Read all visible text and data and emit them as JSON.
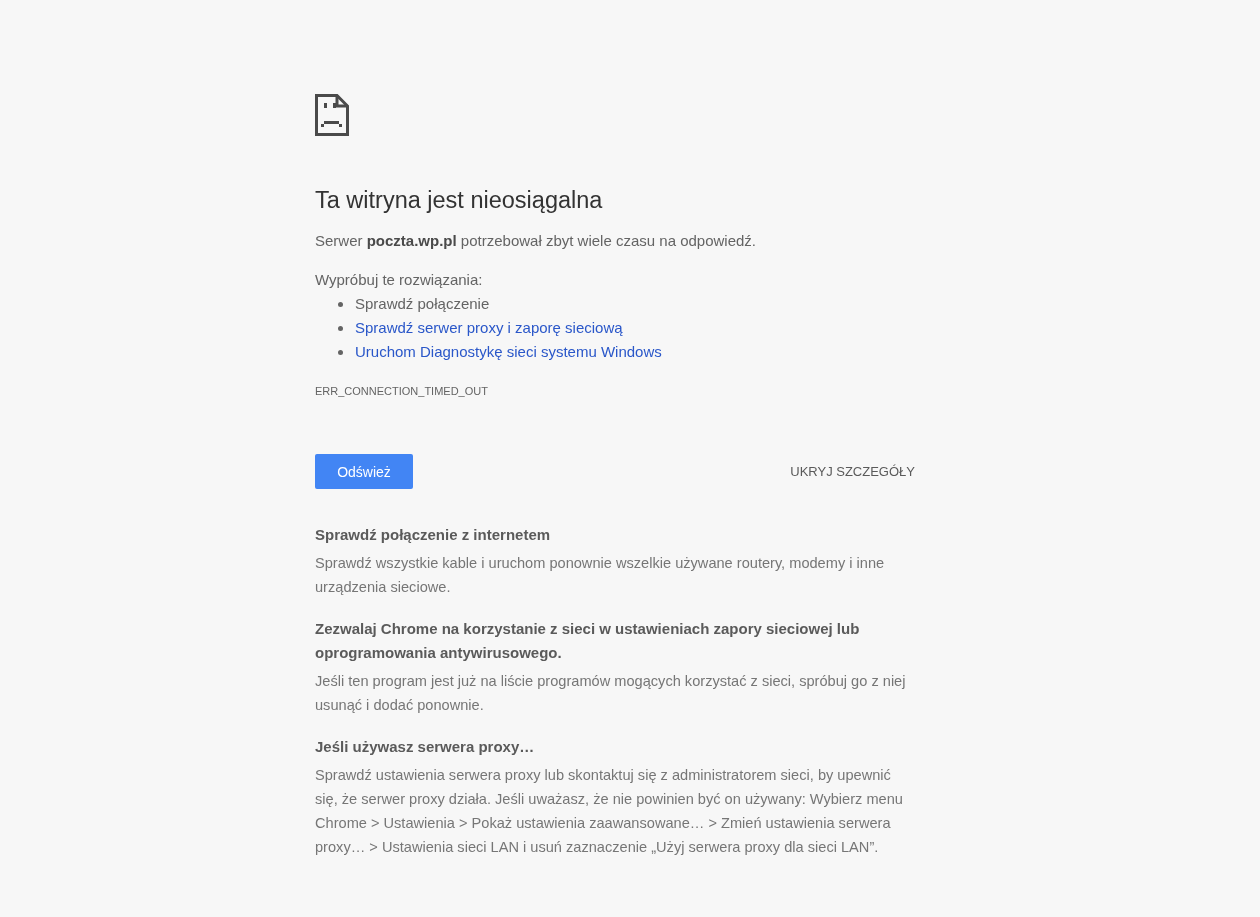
{
  "title": "Ta witryna jest nieosiągalna",
  "summary": "Serwer **poczta.wp.pl** potrzebował zbyt wiele czasu na odpowiedź.",
  "suggestions": {
    "intro": "Wypróbuj te rozwiązania:",
    "items": [
      {
        "kind": "text",
        "text": "Sprawdź połączenie"
      },
      {
        "kind": "link",
        "text": "Sprawdź serwer proxy i zaporę sieciową"
      },
      {
        "kind": "link",
        "text": "Uruchom Diagnostykę sieci systemu Windows"
      }
    ]
  },
  "error_code": "ERR_CONNECTION_TIMED_OUT",
  "buttons": {
    "reload": "Odśwież",
    "details_toggle": "UKRYJ SZCZEGÓŁY"
  },
  "details": [
    {
      "title": "Sprawdź połączenie z internetem",
      "body": "Sprawdź wszystkie kable i uruchom ponownie wszelkie używane routery, modemy i inne urządzenia sieciowe."
    },
    {
      "title": "Zezwalaj Chrome na korzystanie z sieci w ustawieniach zapory sieciowej lub oprogramowania antywirusowego.",
      "body": "Jeśli ten program jest już na liście programów mogących korzystać z sieci, spróbuj go z niej usunąć i dodać ponownie."
    },
    {
      "title": "Jeśli używasz serwera proxy…",
      "body": "Sprawdź ustawienia serwera proxy lub skontaktuj się z administratorem sieci, by upewnić się, że serwer proxy działa. Jeśli uważasz, że nie powinien być on używany: Wybierz menu Chrome > Ustawienia > Pokaż ustawienia zaawansowane… > Zmień ustawienia serwera proxy… > Ustawienia sieci LAN i usuń zaznaczenie „Użyj serwera proxy dla sieci LAN”."
    }
  ]
}
